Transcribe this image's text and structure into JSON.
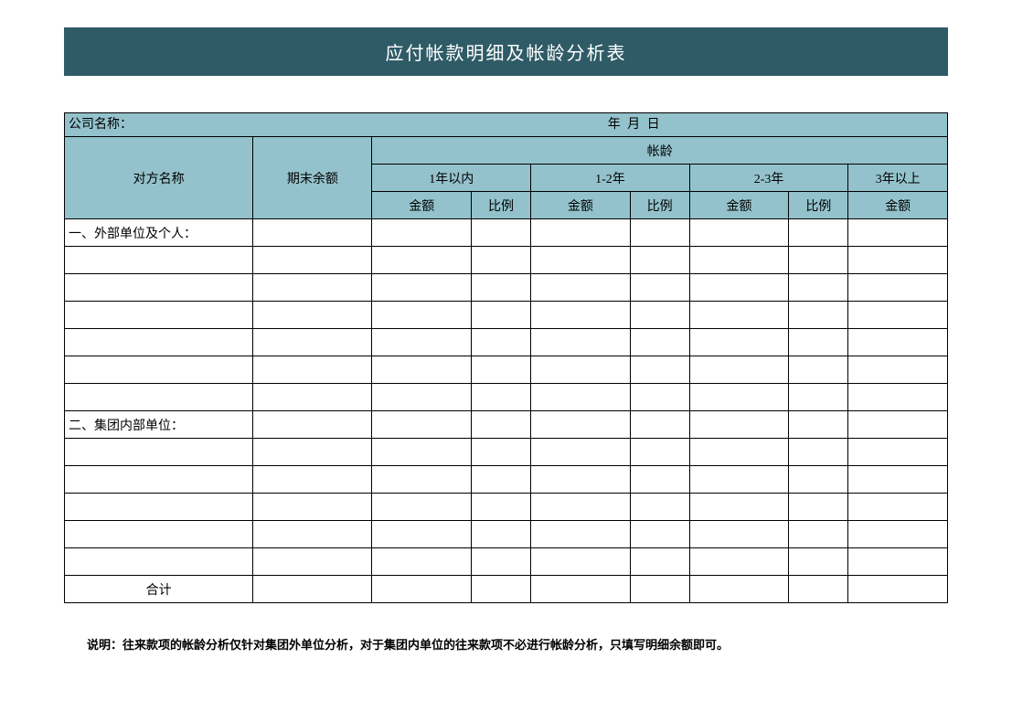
{
  "title": "应付帐款明细及帐龄分析表",
  "info": {
    "company_label": "公司名称：",
    "date_label": "年    月     日"
  },
  "headers": {
    "counterparty": "对方名称",
    "ending_balance": "期末余额",
    "aging": "帐龄",
    "within1y": "1年以内",
    "y1_2": "1-2年",
    "y2_3": "2-3年",
    "over3y": "3年以上",
    "amount": "金额",
    "ratio": "比例"
  },
  "rows": {
    "section1": "一、外部单位及个人：",
    "section2": "二、集团内部单位：",
    "total": "合计"
  },
  "footnote": "说明：往来款项的帐龄分析仅针对集团外单位分析，对于集团内单位的往来款项不必进行帐龄分析，只填写明细余额即可。"
}
